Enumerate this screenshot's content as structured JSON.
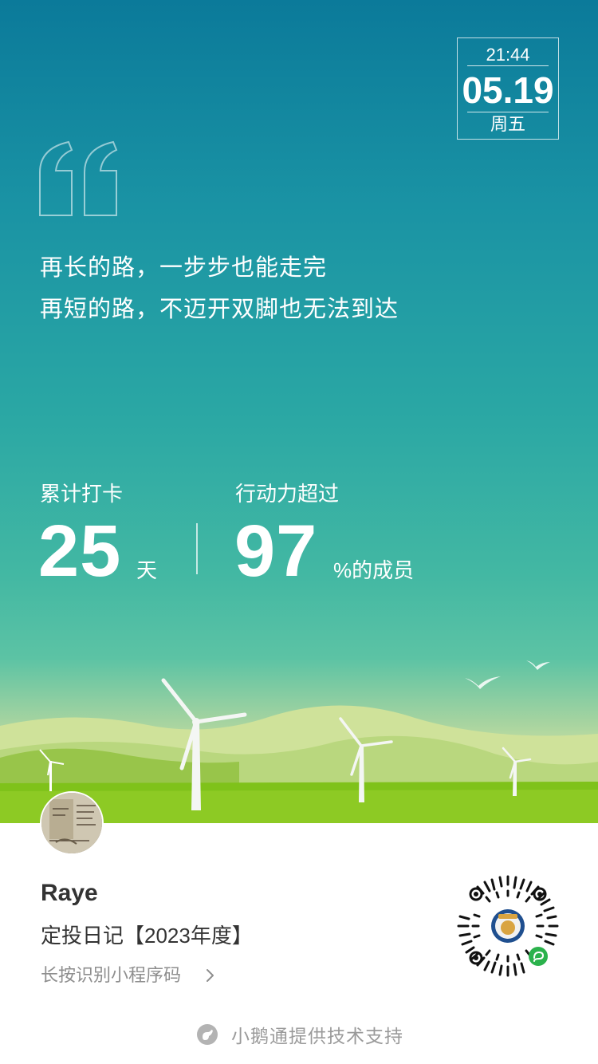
{
  "date_box": {
    "time": "21:44",
    "date": "05.19",
    "weekday": "周五"
  },
  "quote": {
    "line1": "再长的路，一步步也能走完",
    "line2": "再短的路，不迈开双脚也无法到达"
  },
  "stats": {
    "checkin_label": "累计打卡",
    "checkin_value": "25",
    "checkin_unit": "天",
    "action_label": "行动力超过",
    "action_value": "97",
    "action_unit": "%的成员"
  },
  "card": {
    "user_name": "Raye",
    "program_name": "定投日记【2023年度】",
    "hint": "长按识别小程序码"
  },
  "footer": {
    "text": "小鹅通提供技术支持"
  },
  "colors": {
    "sky_top": "#0b7a9a",
    "sky_bottom": "#5cc3a4",
    "grass": "#7fc21a",
    "hint_gray": "#8e8e8e"
  }
}
